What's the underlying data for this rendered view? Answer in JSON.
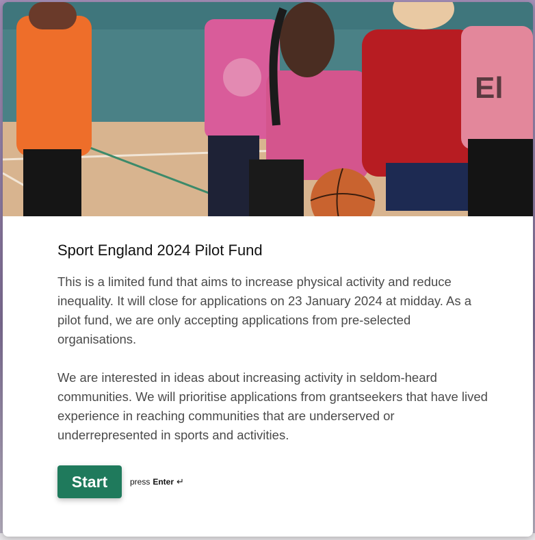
{
  "hero": {
    "image_icon": "photo-girls-playing-basketball"
  },
  "form": {
    "title": "Sport England 2024 Pilot Fund",
    "paragraphs": [
      "This is a limited fund that aims to increase physical activity and reduce inequality. It will close for applications on 23 January 2024 at midday. As a pilot fund, we are only accepting applications from pre-selected organisations.",
      "We are interested in ideas about increasing activity in seldom-heard communities. We will prioritise applications from grantseekers that have lived experience in reaching communities that are underserved or underrepresented in sports and activities."
    ],
    "start_label": "Start",
    "hint_press": "press",
    "hint_key": "Enter",
    "hint_icon": "↵"
  },
  "colors": {
    "button": "#1f7a5c",
    "title": "#111111",
    "body_text": "#4a4a4a"
  }
}
